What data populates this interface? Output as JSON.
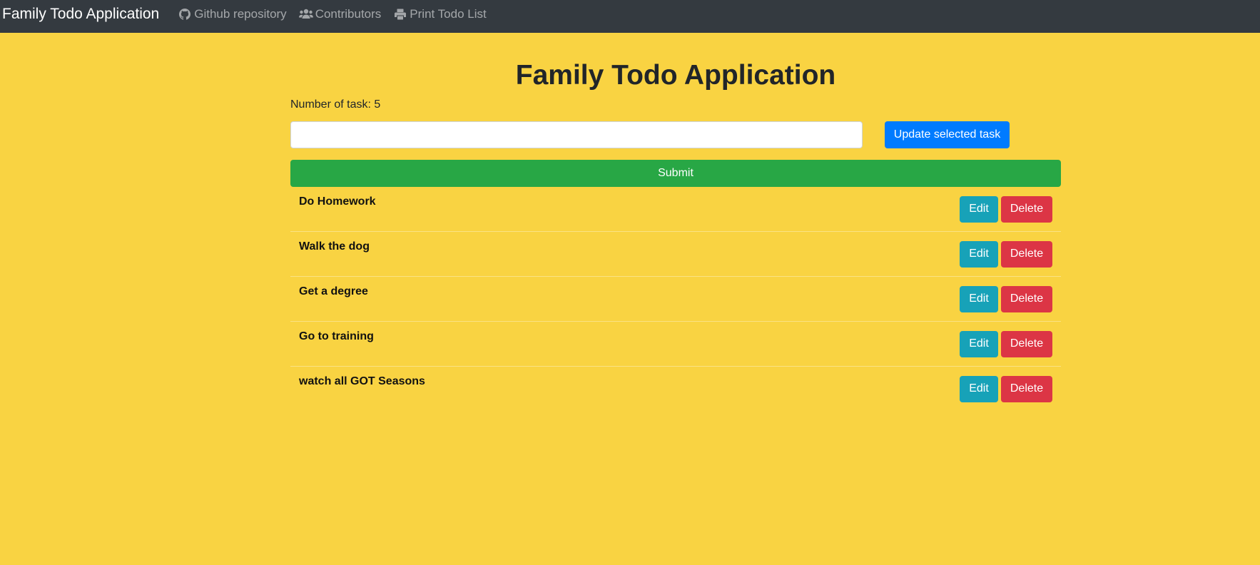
{
  "navbar": {
    "brand": "Family Todo Application",
    "links": [
      {
        "label": "Github repository",
        "icon": "github-icon"
      },
      {
        "label": "Contributors",
        "icon": "users-icon"
      },
      {
        "label": "Print Todo List",
        "icon": "print-icon"
      }
    ]
  },
  "main": {
    "title": "Family Todo Application",
    "task_count_text": "Number of task: 5",
    "input": {
      "value": "",
      "placeholder": ""
    },
    "update_button_label": "Update selected task",
    "submit_button_label": "Submit"
  },
  "tasks": [
    {
      "label": "Do Homework",
      "edit_label": "Edit",
      "delete_label": "Delete"
    },
    {
      "label": "Walk the dog",
      "edit_label": "Edit",
      "delete_label": "Delete"
    },
    {
      "label": "Get a degree",
      "edit_label": "Edit",
      "delete_label": "Delete"
    },
    {
      "label": "Go to training",
      "edit_label": "Edit",
      "delete_label": "Delete"
    },
    {
      "label": "watch all GOT Seasons",
      "edit_label": "Edit",
      "delete_label": "Delete"
    }
  ],
  "colors": {
    "page_background": "#f9d342",
    "navbar_background": "#343a40",
    "update_button": "#007bff",
    "submit_button": "#28a745",
    "edit_button": "#17a2b8",
    "delete_button": "#dc3545"
  }
}
